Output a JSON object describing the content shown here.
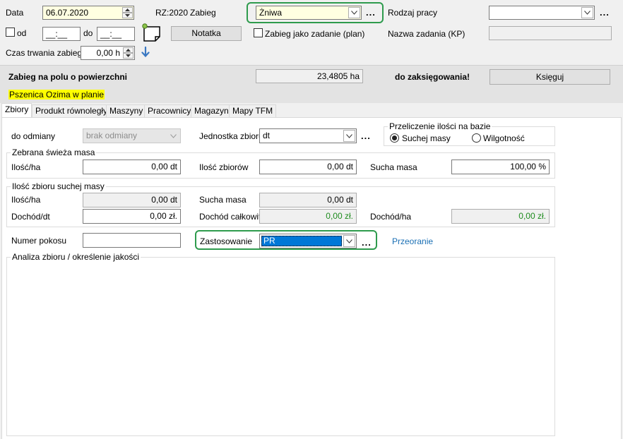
{
  "header": {
    "date_label": "Data",
    "date_value": "06.07.2020",
    "rz_label": "RZ:2020",
    "zabieg_label": "Zabieg",
    "zabieg_value": "Żniwa",
    "rodzaj_label": "Rodzaj pracy",
    "rodzaj_value": "",
    "od_label": "od",
    "od_value": "__:__",
    "do_label": "do",
    "do_value": "__:__",
    "notatka_button": "Notatka",
    "zadanie_label": "Zabieg jako zadanie (plan)",
    "nazwa_zadania_label": "Nazwa zadania (KP)",
    "nazwa_zadania_value": "",
    "czas_label": "Czas trwania zabiegu",
    "czas_value": "0,00 h",
    "dots": "..."
  },
  "summary": {
    "title": "Zabieg na polu o powierzchni",
    "area_value": "23,4805 ha",
    "status": "do zaksięgowania!",
    "ksieguj_button": "Księguj",
    "crop_plan": "Pszenica Ozima w planie"
  },
  "tabs": [
    "Zbiory",
    "Produkt równoległy",
    "Maszyny",
    "Pracownicy",
    "Magazyn",
    "Mapy TFM"
  ],
  "zbiory": {
    "do_odmiany_label": "do odmiany",
    "do_odmiany_value": "brak odmiany",
    "jednostka_label": "Jednostka zbioru",
    "jednostka_value": "dt",
    "przeliczenie_title": "Przeliczenie ilości na bazie",
    "radio_suchej": "Suchej masy",
    "radio_wilgotnosc": "Wilgotność",
    "selected_basis": "Suchej masy",
    "swieza_title": "Zebrana świeża masa",
    "ilosc_ha_label": "Ilość/ha",
    "ilosc_ha_value": "0,00 dt",
    "ilosc_zbiorow_label": "Ilość zbiorów",
    "ilosc_zbiorow_value": "0,00 dt",
    "sucha_masa_label": "Sucha masa",
    "sucha_masa_value": "100,00 %",
    "sucha_title": "Ilość zbioru suchej masy",
    "s_ilosc_ha_label": "Ilość/ha",
    "s_ilosc_ha_value": "0,00 dt",
    "s_sucha_masa_label": "Sucha masa",
    "s_sucha_masa_value": "0,00 dt",
    "dochod_dt_label": "Dochód/dt",
    "dochod_dt_value": "0,00 zł.",
    "dochod_calk_label": "Dochód całkowity",
    "dochod_calk_value": "0,00 zł.",
    "dochod_ha_label": "Dochód/ha",
    "dochod_ha_value": "0,00 zł.",
    "numer_pokosu_label": "Numer pokosu",
    "numer_pokosu_value": "",
    "zastosowanie_label": "Zastosowanie",
    "zastosowanie_value": "PR",
    "przeoranie_link": "Przeoranie",
    "analiza_title": "Analiza zbioru / określenie jakości"
  },
  "colors": {
    "highlight_green": "#2e9b4d",
    "crop_yellow": "#ffff00",
    "link_blue": "#1a6fb4",
    "selection_blue": "#0078d7"
  }
}
